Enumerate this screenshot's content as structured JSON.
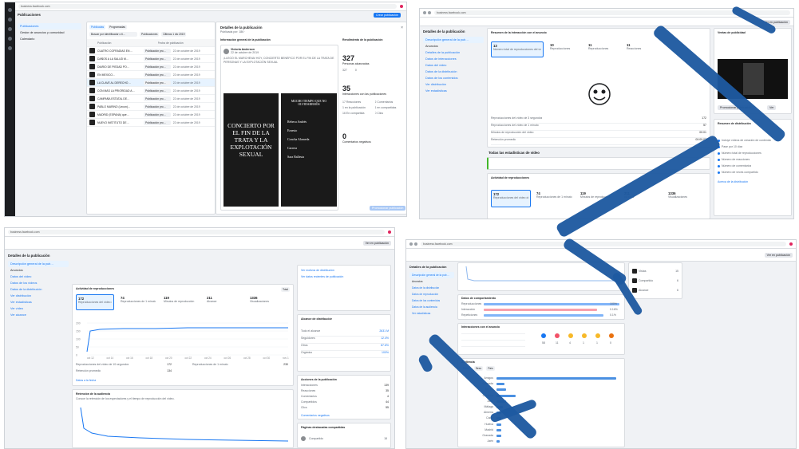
{
  "p1": {
    "url": "business.facebook.com",
    "page_title": "Publicaciones",
    "create_button": "Crear publicación",
    "nav": [
      "Publicaciones",
      "Gestor de anuncios y comunidad",
      "Calendario"
    ],
    "tabs": [
      "Publicadas",
      "Programadas"
    ],
    "search_placeholder": "Buscar por identificador o ti…",
    "filter1": "Publicaciones",
    "filter2": "Últimos 1 dic 2019",
    "columns": [
      "Publicación",
      "Fecha de publicación"
    ],
    "rows": [
      {
        "title": "CUATRO COFRADÍAS EN…",
        "status": "Publicación pro…",
        "date": "22 de octubre de 2019"
      },
      {
        "title": "DAÑOS A LA SALUD M…",
        "status": "Publicación pro…",
        "date": "22 de octubre de 2019"
      },
      {
        "title": "DIARIO DE PIEDAD PO…",
        "status": "Publicación pro…",
        "date": "22 de octubre de 2019"
      },
      {
        "title": "EN MEXICO…",
        "status": "Publicación pro…",
        "date": "22 de octubre de 2019"
      },
      {
        "title": "LA CLAVE AL DERECHO…",
        "status": "Publicación pro…",
        "date": "22 de octubre de 2019"
      },
      {
        "title": "CON MÁS LA PRIORIDAD A…",
        "status": "Publicación pro…",
        "date": "22 de octubre de 2019"
      },
      {
        "title": "CAMPAÑA ESTATAL DE…",
        "status": "Publicación pro…",
        "date": "22 de octubre de 2019"
      },
      {
        "title": "PABLO MARINO (Lecon)…",
        "status": "Publicación pro…",
        "date": "22 de octubre de 2019"
      },
      {
        "title": "MADRID (ESPANA) que…",
        "status": "Publicación pro…",
        "date": "22 de octubre de 2019"
      },
      {
        "title": "NUEVO INSTITUTO DE…",
        "status": "Publicación pro…",
        "date": "22 de octubre de 2019"
      }
    ],
    "detail_title": "Detalles de la publicación",
    "detail_sub": "Publicada por: 186 ·",
    "detail_info_head": "Información general de la publicación",
    "post_author": "Victoria Anderson",
    "post_date": "22 de octubre de 2019",
    "post_text": "¡LLEGÓ EL MARCHENA! HOY, CONCIERTO BENÉFICO POR EL FIN DE LA TRATA DE PERSONAS Y LA EXPLOTACIÓN SEXUAL",
    "poster_left": "CONCIERTO POR EL FIN DE LA TRATA Y LA EXPLOTACIÓN SEXUAL",
    "poster_right_head": "MUCHO TIEMPO QUE NO OLVIDAREMOS",
    "poster_right_names": [
      "Rebeca Andrés",
      "Ernesto",
      "Concha Alameda",
      "Carrera",
      "Sara Ballesta"
    ],
    "metrics_head": "Rendimiento de la publicación",
    "reach_value": "327",
    "reach_label": "Personas alcanzadas",
    "reach_sub1": "327",
    "reach_sub2": "0",
    "interactions_value": "35",
    "interactions_label": "Interacciones con las publicaciones",
    "interaction_lines": [
      "17 Reacciones",
      "2 Comentarios",
      "1 en la publicación",
      "1 en compartidas",
      "16 En compartida",
      "0 Clics"
    ],
    "negative_value": "0",
    "negative_label": "Comentarios negativos",
    "footer_button": "Promocionar publicación"
  },
  "p2": {
    "url": "business.facebook.com",
    "title": "Detalles de la publicación",
    "top_button": "Ver en publicación",
    "nav": [
      "Descripción general de la pub…",
      "Anuncios",
      "Detalles de la publicación",
      "Datos de interacciones",
      "Datos del vídeo",
      "Datos de la distribución",
      "Datos de los contenidos",
      "Ver distribución",
      "Ver estadísticas"
    ],
    "overview_head": "Resumen de la interacción con el anuncio",
    "tiles": [
      {
        "value": "13",
        "label": "Número total de reproducciones del vídeo de 3 segundos"
      },
      {
        "value": "10",
        "label": "Reproducciones"
      },
      {
        "value": "11",
        "label": "Reproducciones"
      },
      {
        "value": "11",
        "label": "Reacciones"
      }
    ],
    "stats": [
      {
        "label": "Reproducciones del vídeo de 3 segundos",
        "value": "172"
      },
      {
        "label": "Reproducciones del vídeo de 1 minuto",
        "value": "57"
      },
      {
        "label": "Minutos de reproducción del vídeo",
        "value": "00:01"
      },
      {
        "label": "Retención promedio",
        "value": "00:00:07"
      }
    ],
    "video_section": "Todas las estadísticas de vídeo",
    "lower_head": "Actividad de reproducciones",
    "lower_tiles": [
      "172",
      "74",
      "119",
      "211",
      "1336"
    ],
    "lower_labels": [
      "Reproducciones del vídeo de 3 segundos",
      "Reproducciones de 1 minuto",
      "Minutos de reproducción",
      "Alcance",
      "Visualizaciones"
    ],
    "side_head": "Ventas de publicidad",
    "side_buttons": [
      "Promocionar publicación",
      "Ver"
    ],
    "dist_head": "Resumen de distribución",
    "dist_items": [
      "Incluye vídeos de creación de contenido",
      "Pase por 10 días",
      "Número total de reproducciones",
      "Número de reacciones",
      "Número de comentarios",
      "Número de veces compartido"
    ],
    "dist_foot": "Acerca de la distribución"
  },
  "p3": {
    "url": "business.facebook.com",
    "title": "Detalles de la publicación",
    "top_button": "Ver en publicación",
    "nav": [
      "Descripción general de la pub…",
      "Anuncios",
      "Datos del vídeo",
      "Datos de los vídeos",
      "Datos de la distribución",
      "Ver distribución",
      "Ver estadísticas",
      "Ver vídeo",
      "Ver alcance"
    ],
    "activity_head": "Actividad de reproducciones",
    "activity_filter": "Total",
    "tiles": [
      {
        "value": "172",
        "label": "Reproducciones del vídeo de 3 segundos"
      },
      {
        "value": "74",
        "label": "Reproducciones de 1 minuto"
      },
      {
        "value": "119",
        "label": "Minutos de reproducción"
      },
      {
        "value": "211",
        "label": "Alcance"
      },
      {
        "value": "1336",
        "label": "Visualizaciones"
      }
    ],
    "chart_y_ticks": [
      "200",
      "150",
      "100",
      "50",
      "0"
    ],
    "chart_x_ticks": [
      "oct 12",
      "oct 14",
      "oct 16",
      "oct 18",
      "oct 20",
      "oct 22",
      "oct 24",
      "oct 26",
      "oct 28",
      "oct 30",
      "nov 1"
    ],
    "stats_left": [
      {
        "label": "Reproducciones del vídeo de 10 segundos",
        "value": "172"
      },
      {
        "label": "Retención promedio",
        "value": "134"
      }
    ],
    "stats_right": [
      {
        "label": "Reproducciones de 1 minuto",
        "value": "230"
      }
    ],
    "more_link": "Datos a la fecha",
    "retention_head": "Retención de la audiencia",
    "retention_sub": "Conoce la retención de los espectadores y el tiempo de reproducción del vídeo.",
    "side_items": [
      "Ver motivos de distribución",
      "Ver datos recientes de publicación"
    ],
    "dist_head": "Alcance de distribución",
    "dist_rows": [
      {
        "label": "Todo el alcance",
        "value": "2631 M"
      },
      {
        "label": "Seguidores",
        "value": "12.4%"
      },
      {
        "label": "Otros",
        "value": "87.6%"
      },
      {
        "label": "Orgánico",
        "value": "100%"
      }
    ],
    "actions_head": "Acciones de la publicación",
    "actions": [
      {
        "label": "Interacciones",
        "value": "139"
      },
      {
        "label": "Reacciones",
        "value": "35"
      },
      {
        "label": "Comentarios",
        "value": "4"
      },
      {
        "label": "Compartidos",
        "value": "44"
      },
      {
        "label": "Clics",
        "value": "55"
      }
    ],
    "negative_link": "Comentarios negativos",
    "pages_head": "Páginas destacadas compartidas",
    "pages": [
      {
        "name": "Compartido",
        "value": "18"
      }
    ]
  },
  "p4": {
    "url": "business.facebook.com",
    "title": "Detalles de la publicación",
    "top_button": "Ver en publicación",
    "nav": [
      "Descripción general de la pub…",
      "Anuncios",
      "Datos de la distribución",
      "Datos de reproducción",
      "Datos de los contenidos",
      "Datos de la audiencia",
      "Ver estadísticas"
    ],
    "interactions_head": "Datos de comportamiento",
    "bar_rows": [
      {
        "label": "Reproducciones",
        "value": "100%"
      },
      {
        "label": "Interacción",
        "value": "0.16%"
      },
      {
        "label": "Repeticiones",
        "value": "0.1%"
      }
    ],
    "reactions_head": "Interacciones con el anuncio",
    "reactions": [
      {
        "label": "Me gusta",
        "value": "58"
      },
      {
        "label": "Me encanta",
        "value": "11"
      },
      {
        "label": "Me divierte",
        "value": "4"
      },
      {
        "label": "Me asombra",
        "value": "1"
      },
      {
        "label": "Me entristece",
        "value": "1"
      },
      {
        "label": "Me enoja",
        "value": "0"
      }
    ],
    "audience_head": "Audiencia",
    "audience_tabs": [
      "Edad",
      "Sexo",
      "País"
    ],
    "audience_rows": [
      "Amigos",
      "Granada",
      "Sevilla",
      "Córdoba",
      "Jaén",
      "Málaga",
      "Almería",
      "Cádiz",
      "Huelva",
      "Madrid",
      "Granada",
      "Jaén"
    ],
    "side_items": [
      {
        "name": "Vistas",
        "value": "15"
      },
      {
        "name": "Compartido",
        "value": "6"
      },
      {
        "name": "Alcance",
        "value": "6"
      }
    ]
  },
  "colors": {
    "accent": "#1877f2",
    "mark": "#1e5aa0",
    "orange": "#f7b928",
    "red": "#f25268"
  }
}
